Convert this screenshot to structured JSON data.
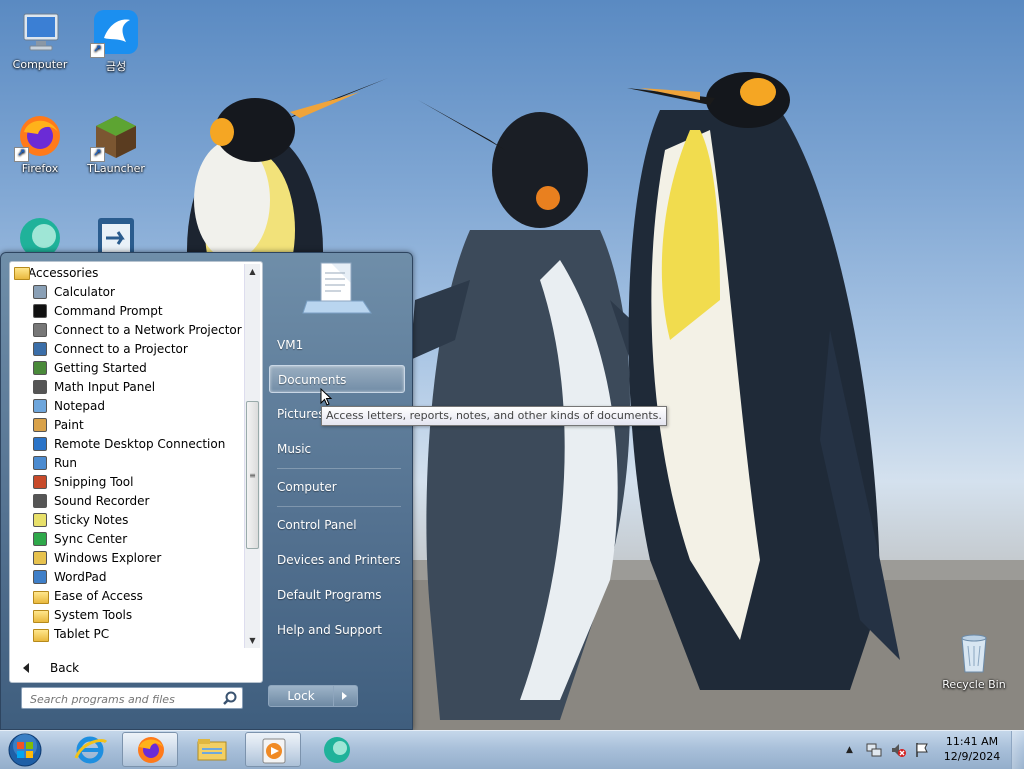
{
  "desktop": {
    "icons": [
      {
        "label": "Computer"
      },
      {
        "label": "금성"
      },
      {
        "label": "Firefox"
      },
      {
        "label": "TLauncher"
      },
      {
        "label": "Recycle Bin"
      }
    ]
  },
  "start_menu": {
    "programs": {
      "folder": "Accessories",
      "items": [
        {
          "label": "Calculator",
          "icon": "calculator-icon"
        },
        {
          "label": "Command Prompt",
          "icon": "command-prompt-icon"
        },
        {
          "label": "Connect to a Network Projector",
          "icon": "network-projector-icon"
        },
        {
          "label": "Connect to a Projector",
          "icon": "projector-icon"
        },
        {
          "label": "Getting Started",
          "icon": "getting-started-icon"
        },
        {
          "label": "Math Input Panel",
          "icon": "math-input-icon"
        },
        {
          "label": "Notepad",
          "icon": "notepad-icon"
        },
        {
          "label": "Paint",
          "icon": "paint-icon"
        },
        {
          "label": "Remote Desktop Connection",
          "icon": "remote-desktop-icon"
        },
        {
          "label": "Run",
          "icon": "run-icon"
        },
        {
          "label": "Snipping Tool",
          "icon": "snipping-tool-icon"
        },
        {
          "label": "Sound Recorder",
          "icon": "microphone-icon"
        },
        {
          "label": "Sticky Notes",
          "icon": "sticky-notes-icon"
        },
        {
          "label": "Sync Center",
          "icon": "sync-icon"
        },
        {
          "label": "Windows Explorer",
          "icon": "explorer-icon"
        },
        {
          "label": "WordPad",
          "icon": "wordpad-icon"
        },
        {
          "label": "Ease of Access",
          "icon": "folder-icon"
        },
        {
          "label": "System Tools",
          "icon": "folder-icon"
        },
        {
          "label": "Tablet PC",
          "icon": "folder-icon"
        }
      ]
    },
    "back_label": "Back",
    "search_placeholder": "Search programs and files",
    "right_items": {
      "user": "VM1",
      "documents": "Documents",
      "pictures": "Pictures",
      "music": "Music",
      "computer": "Computer",
      "control_panel": "Control Panel",
      "devices": "Devices and Printers",
      "defaults": "Default Programs",
      "help": "Help and Support"
    },
    "lock_label": "Lock",
    "tooltip": "Access letters, reports, notes, and other kinds of documents."
  },
  "taskbar": {
    "pinned": [
      "start-orb",
      "internet-explorer-icon",
      "firefox-icon",
      "windows-explorer-icon",
      "media-player-icon",
      "app-icon"
    ],
    "clock": {
      "time": "11:41 AM",
      "date": "12/9/2024"
    }
  },
  "colors": {
    "accent": "#52708f",
    "taskbar": "#a9c0da",
    "highlight": "#c9d7e6"
  }
}
